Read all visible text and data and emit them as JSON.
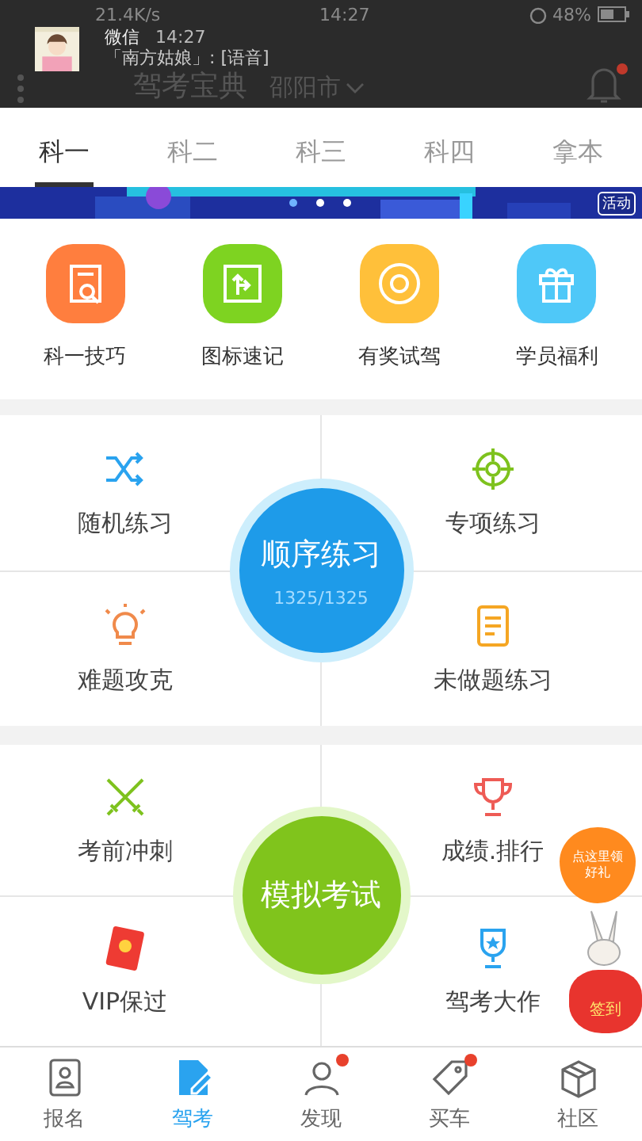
{
  "status_bar": {
    "network_speed": "21.4K/s",
    "time": "14:27",
    "battery": "48%"
  },
  "notification": {
    "app": "微信",
    "time": "14:27",
    "message": "「南方姑娘」: [语音]"
  },
  "header": {
    "title": "驾考宝典",
    "city": "邵阳市",
    "bell_badge": true
  },
  "tabs": [
    {
      "label": "科一",
      "selected": true
    },
    {
      "label": "科二",
      "selected": false
    },
    {
      "label": "科三",
      "selected": false
    },
    {
      "label": "科四",
      "selected": false
    },
    {
      "label": "拿本",
      "selected": false
    }
  ],
  "banner": {
    "badge": "活动"
  },
  "shortcuts": [
    {
      "label": "科一技巧",
      "kind": "doc",
      "color": "#ff7e3e"
    },
    {
      "label": "图标速记",
      "kind": "sign",
      "color": "#7ed321"
    },
    {
      "label": "有奖试驾",
      "kind": "wheel",
      "color": "#ffc03a"
    },
    {
      "label": "学员福利",
      "kind": "gift",
      "color": "#4fc8f8"
    }
  ],
  "practice": {
    "main": {
      "label": "顺序练习",
      "progress": "1325/1325"
    },
    "items": [
      {
        "label": "随机练习",
        "kind": "shuffle"
      },
      {
        "label": "专项练习",
        "kind": "target"
      },
      {
        "label": "难题攻克",
        "kind": "bulb"
      },
      {
        "label": "未做题练习",
        "kind": "note"
      }
    ]
  },
  "exam": {
    "main": {
      "label": "模拟考试"
    },
    "items": [
      {
        "label": "考前冲刺",
        "kind": "swords"
      },
      {
        "label": "成绩.排行",
        "kind": "cup"
      },
      {
        "label": "VIP保过",
        "kind": "envelope"
      },
      {
        "label": "驾考大作",
        "kind": "trophy"
      }
    ]
  },
  "promo": {
    "balloon": "点这里领好礼",
    "bag": "签到"
  },
  "nav": [
    {
      "label": "报名",
      "kind": "card",
      "selected": false,
      "badge": false
    },
    {
      "label": "驾考",
      "kind": "edit",
      "selected": true,
      "badge": false
    },
    {
      "label": "发现",
      "kind": "person",
      "selected": false,
      "badge": true
    },
    {
      "label": "买车",
      "kind": "tag",
      "selected": false,
      "badge": true
    },
    {
      "label": "社区",
      "kind": "box",
      "selected": false,
      "badge": false
    }
  ]
}
